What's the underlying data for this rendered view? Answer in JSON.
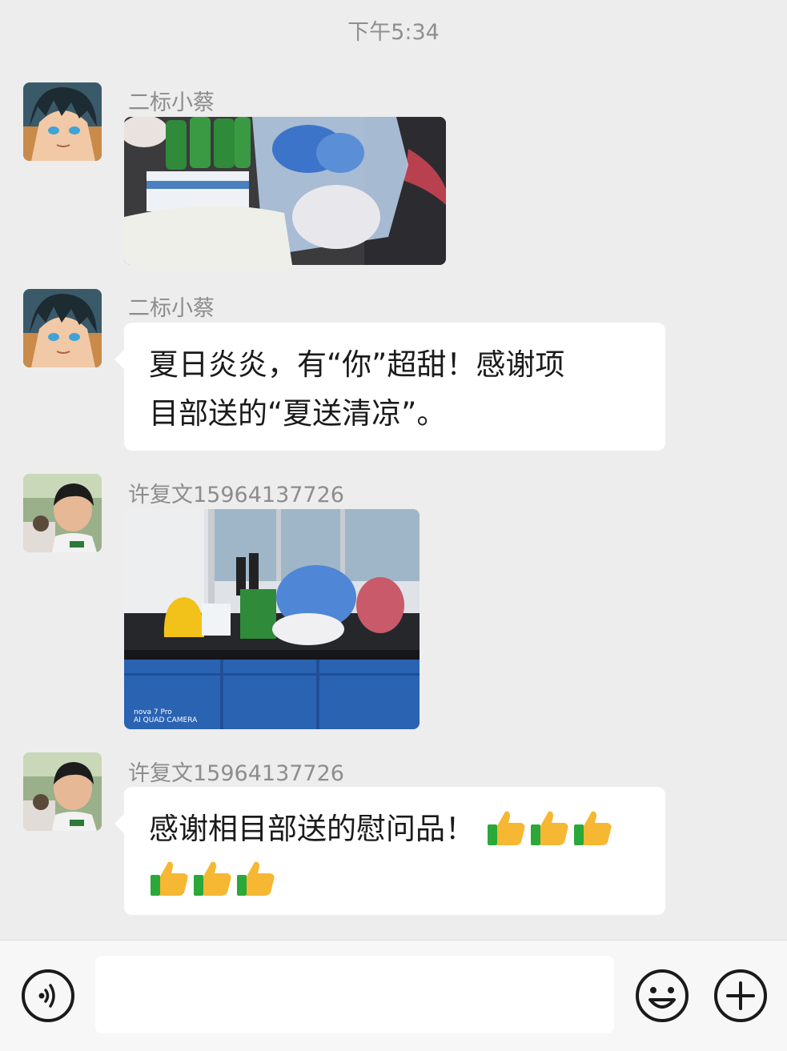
{
  "header": {
    "timestamp": "下午5:34"
  },
  "messages": [
    {
      "type": "image",
      "sender": "二标小蔡",
      "avatar": "anime-avatar",
      "image": "photo-drinks-and-supplies"
    },
    {
      "type": "text",
      "sender": "二标小蔡",
      "avatar": "anime-avatar",
      "text_line1": "夏日炎炎，有“你”超甜！感谢项",
      "text_line2": "目部送的“夏送清凉”。"
    },
    {
      "type": "image",
      "sender": "许复文15964137726",
      "avatar": "boy-photo-avatar",
      "image": "photo-office-desk-supplies",
      "watermark_line1": "nova 7 Pro",
      "watermark_line2": "AI QUAD CAMERA"
    },
    {
      "type": "text",
      "sender": "许复文15964137726",
      "avatar": "boy-photo-avatar",
      "text_line1": "感谢相目部送的慰问品！",
      "emoji": "thumbs-up",
      "emoji_count": 6
    }
  ],
  "input_bar": {
    "voice_icon": "voice-icon",
    "emoji_icon": "emoji-icon",
    "plus_icon": "plus-icon",
    "input_value": ""
  },
  "colors": {
    "background": "#ededed",
    "bubble": "#ffffff",
    "name": "#8d8d8d",
    "text": "#1a1a1a"
  }
}
